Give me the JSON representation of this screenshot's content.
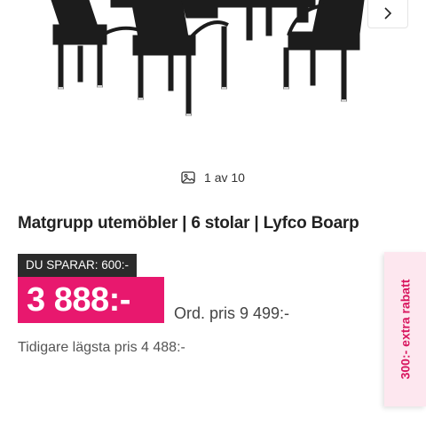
{
  "gallery": {
    "counter_text": "1 av 10",
    "image_icon": "image-icon",
    "next_icon": "chevron-right-icon"
  },
  "product": {
    "title": "Matgrupp utemöbler | 6 stolar | Lyfco Boarp"
  },
  "pricing": {
    "save_label": "DU SPARAR: 600:-",
    "price": "3 888:-",
    "ord_price": "Ord. pris 9 499:-",
    "previous_lowest": "Tidigare lägsta pris 4 488:-"
  },
  "promo_tab": {
    "label": "300:- extra rabatt"
  },
  "colors": {
    "price_bg": "#e8186e",
    "save_bg": "#2b2b2b",
    "promo_bg": "#fde7ef",
    "promo_text": "#d8175f"
  }
}
